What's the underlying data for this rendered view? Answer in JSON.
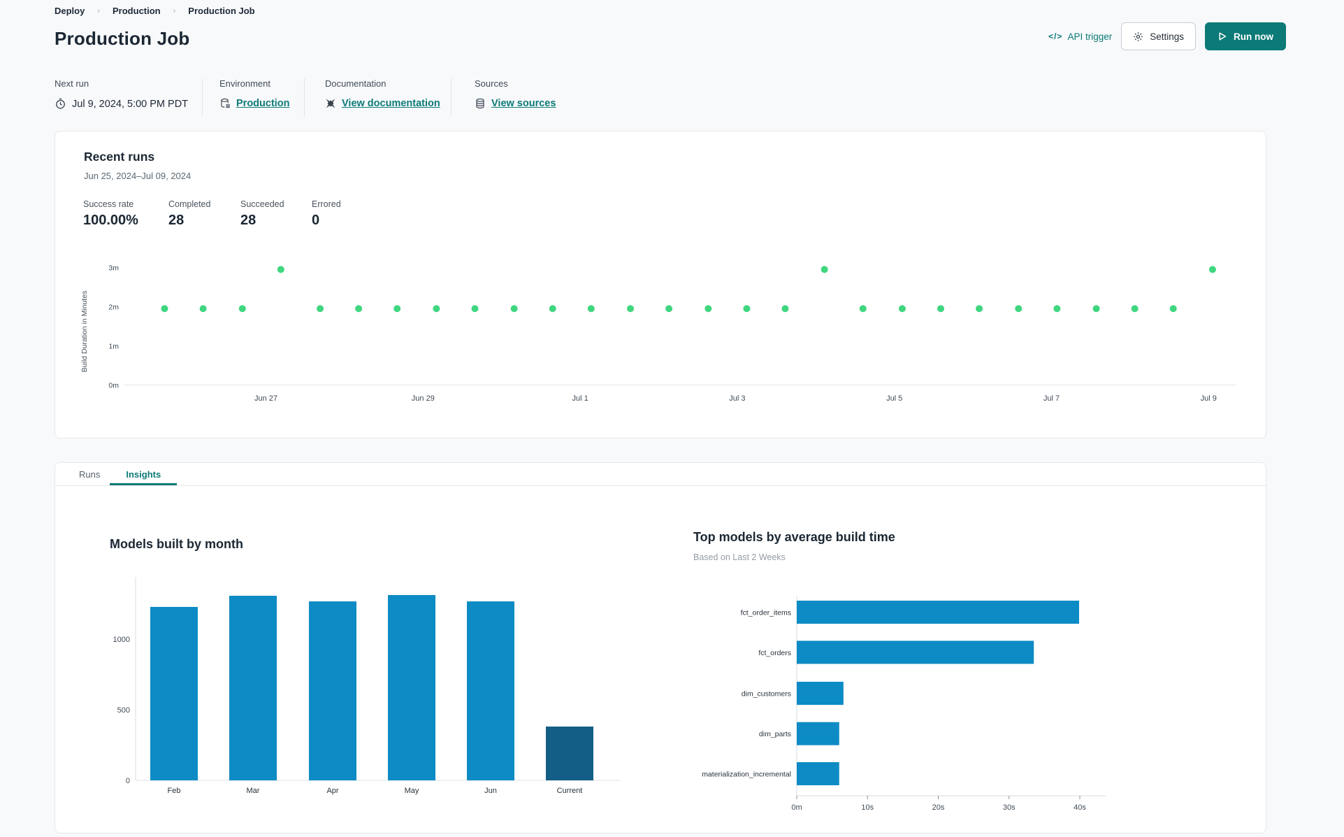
{
  "breadcrumb": {
    "items": [
      {
        "label": "Deploy"
      },
      {
        "label": "Production"
      },
      {
        "label": "Production Job"
      }
    ]
  },
  "header": {
    "title": "Production Job",
    "api_trigger_label": "API trigger",
    "api_trigger_glyph": "</>",
    "settings_label": "Settings",
    "run_now_label": "Run now"
  },
  "meta": {
    "columns": [
      {
        "label": "Next run",
        "value": "Jul 9, 2024, 5:00 PM PDT",
        "icon": "clock-icon",
        "is_link": false
      },
      {
        "label": "Environment",
        "value": "Production",
        "icon": "environment-database-icon",
        "is_link": true
      },
      {
        "label": "Documentation",
        "value": "View documentation",
        "icon": "dbt-docs-icon",
        "is_link": true
      },
      {
        "label": "Sources",
        "value": "View sources",
        "icon": "sources-database-icon",
        "is_link": true
      }
    ]
  },
  "recent_runs": {
    "title": "Recent runs",
    "date_range": "Jun 25, 2024–Jul 09, 2024",
    "stats": [
      {
        "label": "Success rate",
        "value": "100.00%"
      },
      {
        "label": "Completed",
        "value": "28"
      },
      {
        "label": "Succeeded",
        "value": "28"
      },
      {
        "label": "Errored",
        "value": "0"
      }
    ]
  },
  "tabs": [
    {
      "label": "Runs",
      "active": false
    },
    {
      "label": "Insights",
      "active": true
    }
  ],
  "colors": {
    "teal": "#0c7a77",
    "dot_green": "#3fd67f",
    "bar_blue": "#0d8bc4",
    "bar_dark_blue": "#135e86",
    "axis_line": "#dfe3e6",
    "tick_text": "#3e4954"
  },
  "chart_data": [
    {
      "id": "build-duration-scatter",
      "type": "scatter",
      "ylabel": "Build Duration in Minutes",
      "yticks": [
        {
          "label": "0m",
          "value": 0
        },
        {
          "label": "1m",
          "value": 1
        },
        {
          "label": "2m",
          "value": 2
        },
        {
          "label": "3m",
          "value": 3
        }
      ],
      "ylim": [
        0,
        3.3
      ],
      "xticks": [
        {
          "label": "Jun 27",
          "day": 2
        },
        {
          "label": "Jun 29",
          "day": 4
        },
        {
          "label": "Jul 1",
          "day": 6
        },
        {
          "label": "Jul 3",
          "day": 8
        },
        {
          "label": "Jul 5",
          "day": 10
        },
        {
          "label": "Jul 7",
          "day": 12
        },
        {
          "label": "Jul 9",
          "day": 14
        }
      ],
      "x_day_zero": "Jun 25, 2024",
      "point_color": "#3fd67f",
      "points": [
        {
          "day": 0.71,
          "minutes": 1.95
        },
        {
          "day": 1.2,
          "minutes": 1.95
        },
        {
          "day": 1.7,
          "minutes": 1.95
        },
        {
          "day": 2.19,
          "minutes": 2.95
        },
        {
          "day": 2.69,
          "minutes": 1.95
        },
        {
          "day": 3.18,
          "minutes": 1.95
        },
        {
          "day": 3.67,
          "minutes": 1.95
        },
        {
          "day": 4.17,
          "minutes": 1.95
        },
        {
          "day": 4.66,
          "minutes": 1.95
        },
        {
          "day": 5.16,
          "minutes": 1.95
        },
        {
          "day": 5.65,
          "minutes": 1.95
        },
        {
          "day": 6.14,
          "minutes": 1.95
        },
        {
          "day": 6.64,
          "minutes": 1.95
        },
        {
          "day": 7.13,
          "minutes": 1.95
        },
        {
          "day": 7.63,
          "minutes": 1.95
        },
        {
          "day": 8.12,
          "minutes": 1.95
        },
        {
          "day": 8.61,
          "minutes": 1.95
        },
        {
          "day": 9.11,
          "minutes": 2.95
        },
        {
          "day": 9.6,
          "minutes": 1.95
        },
        {
          "day": 10.1,
          "minutes": 1.95
        },
        {
          "day": 10.59,
          "minutes": 1.95
        },
        {
          "day": 11.08,
          "minutes": 1.95
        },
        {
          "day": 11.58,
          "minutes": 1.95
        },
        {
          "day": 12.07,
          "minutes": 1.95
        },
        {
          "day": 12.57,
          "minutes": 1.95
        },
        {
          "day": 13.06,
          "minutes": 1.95
        },
        {
          "day": 13.55,
          "minutes": 1.95
        },
        {
          "day": 14.05,
          "minutes": 2.95
        }
      ]
    },
    {
      "id": "models-built-by-month",
      "type": "bar",
      "title": "Models built by month",
      "categories": [
        "Feb",
        "Mar",
        "Apr",
        "May",
        "Jun",
        "Current"
      ],
      "values": [
        1228,
        1307,
        1267,
        1312,
        1267,
        381
      ],
      "bar_colors": [
        "#0d8bc4",
        "#0d8bc4",
        "#0d8bc4",
        "#0d8bc4",
        "#0d8bc4",
        "#135e86"
      ],
      "yticks": [
        0,
        500,
        1000
      ],
      "ylim": [
        0,
        1440
      ],
      "xlabel": "",
      "ylabel": ""
    },
    {
      "id": "top-models-by-average-build-time",
      "type": "bar-horizontal",
      "title": "Top models by average build time",
      "subtitle": "Based on Last 2 Weeks",
      "categories": [
        "fct_order_items",
        "fct_orders",
        "dim_customers",
        "dim_parts",
        "materialization_incremental"
      ],
      "values_seconds": [
        39.9,
        33.5,
        6.6,
        6.0,
        6.0
      ],
      "xticks": [
        {
          "label": "0m",
          "value": 0
        },
        {
          "label": "10s",
          "value": 10
        },
        {
          "label": "20s",
          "value": 20
        },
        {
          "label": "30s",
          "value": 30
        },
        {
          "label": "40s",
          "value": 40
        }
      ],
      "xlim": [
        0,
        44
      ],
      "bar_color": "#0d8bc4"
    }
  ]
}
